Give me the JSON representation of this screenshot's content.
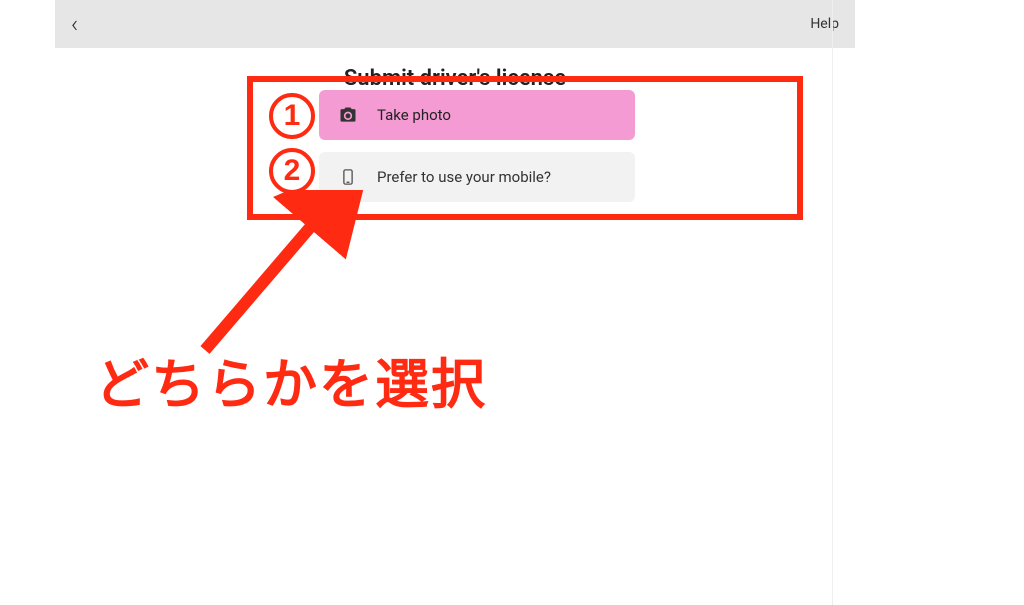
{
  "header": {
    "help_label": "Help"
  },
  "title": "Submit driver's license",
  "options": {
    "take_photo_label": "Take photo",
    "use_mobile_label": "Prefer to use your mobile?"
  },
  "annotations": {
    "badge1": "1",
    "badge2": "2",
    "instruction": "どちらかを選択",
    "accent_color": "#ff2a12"
  }
}
